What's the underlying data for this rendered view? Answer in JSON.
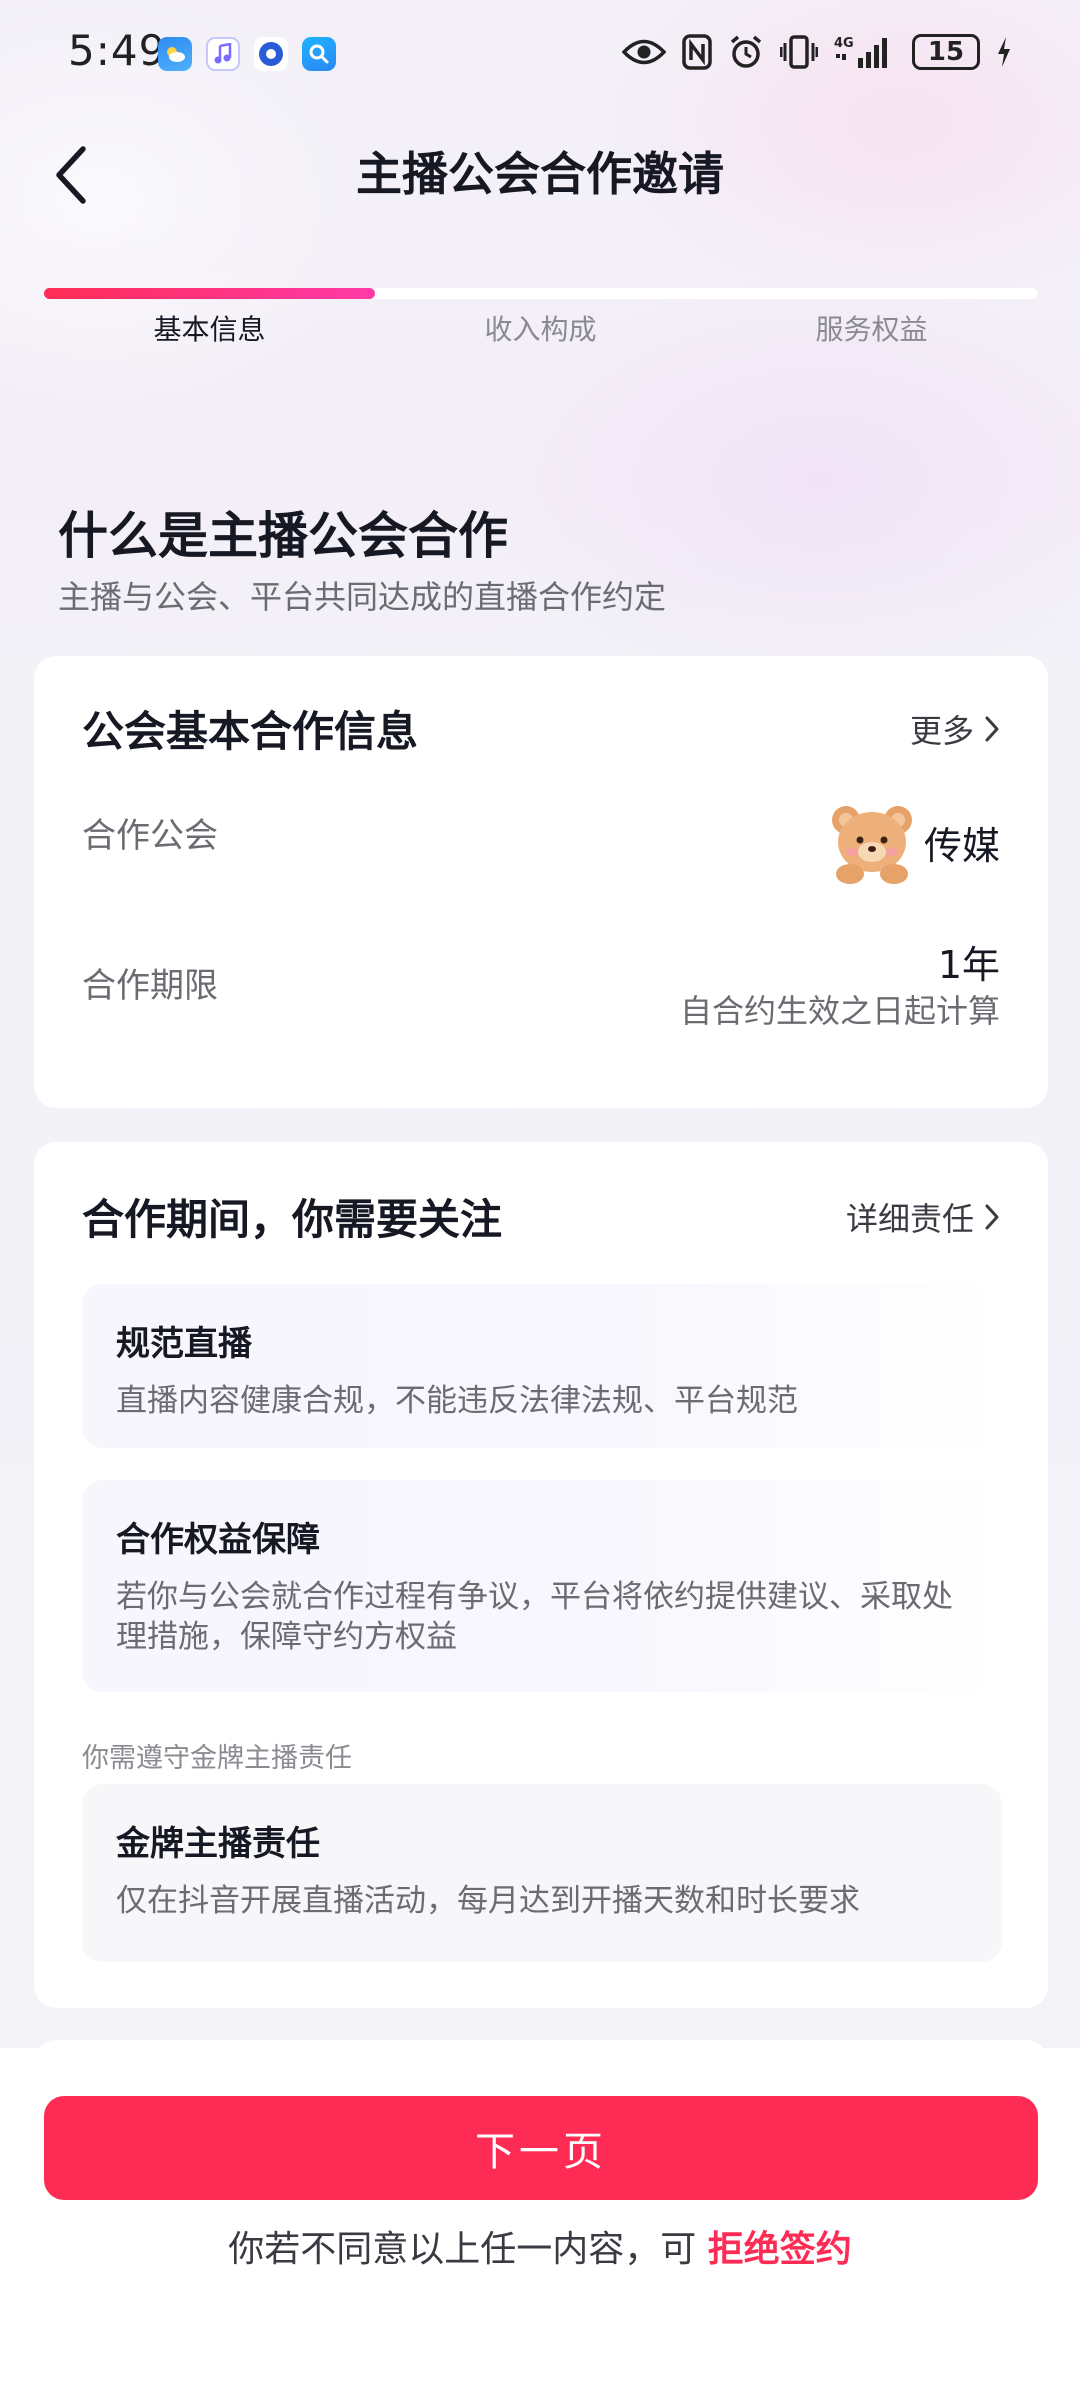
{
  "status_bar": {
    "time": "5:49",
    "battery": "15",
    "network": "4G"
  },
  "header": {
    "title": "主播公会合作邀请"
  },
  "steps": {
    "items": [
      "基本信息",
      "收入构成",
      "服务权益"
    ],
    "active_index": 0,
    "progress": 0.333
  },
  "intro": {
    "title": "什么是主播公会合作",
    "subtitle": "主播与公会、平台共同达成的直播合作约定"
  },
  "basic_info": {
    "title": "公会基本合作信息",
    "more_label": "更多",
    "guild_label": "合作公会",
    "guild_name": "传媒",
    "period_label": "合作期限",
    "period_value": "1年",
    "period_note": "自合约生效之日起计算"
  },
  "attention": {
    "title": "合作期间，你需要关注",
    "detail_label": "详细责任",
    "items": [
      {
        "title": "规范直播",
        "desc": "直播内容健康合规，不能违反法律法规、平台规范"
      },
      {
        "title": "合作权益保障",
        "desc": "若你与公会就合作过程有争议，平台将依约提供建议、采取处理措施，保障守约方权益"
      }
    ],
    "hint": "你需遵守金牌主播责任",
    "gold": {
      "title": "金牌主播责任",
      "desc": "仅在抖音开展直播活动，每月达到开播天数和时长要求"
    }
  },
  "footer": {
    "next_label": "下一页",
    "disagree_text": "你若不同意以上任一内容，可",
    "reject_label": "拒绝签约"
  },
  "colors": {
    "accent": "#fe2c55",
    "accent_gradient_end": "#ff3aa9"
  }
}
